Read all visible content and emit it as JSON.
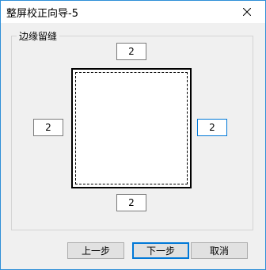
{
  "window": {
    "title": "整屏校正向导-5",
    "close_icon": "close-icon"
  },
  "group": {
    "label": "边缘留缝"
  },
  "margins": {
    "top": "2",
    "left": "2",
    "right": "2",
    "bottom": "2"
  },
  "buttons": {
    "prev": "上一步",
    "next": "下一步",
    "cancel": "取消"
  },
  "colors": {
    "accent": "#0078d7",
    "frame": "#2f8fd8",
    "dialog_bg": "#f0f0f0"
  }
}
